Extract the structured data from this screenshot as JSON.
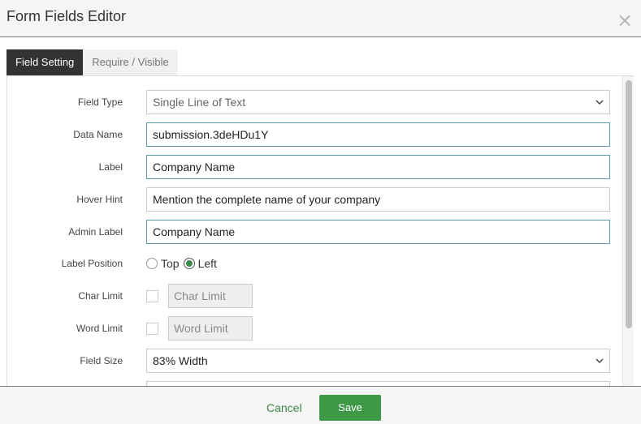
{
  "dialog": {
    "title": "Form Fields Editor",
    "close_icon": "close-icon"
  },
  "tabs": [
    {
      "label": "Field Setting",
      "active": true
    },
    {
      "label": "Require / Visible",
      "active": false
    }
  ],
  "fields": {
    "field_type": {
      "label": "Field Type",
      "value": "Single Line of Text"
    },
    "data_name": {
      "label": "Data Name",
      "value": "submission.3deHDu1Y"
    },
    "label": {
      "label": "Label",
      "value": "Company Name"
    },
    "hover_hint": {
      "label": "Hover Hint",
      "value": "Mention the complete name of your company"
    },
    "admin_label": {
      "label": "Admin Label",
      "value": "Company Name"
    },
    "label_position": {
      "label": "Label Position",
      "options": [
        "Top",
        "Left"
      ],
      "selected": "Left"
    },
    "char_limit": {
      "label": "Char Limit",
      "placeholder": "Char Limit",
      "checked": false
    },
    "word_limit": {
      "label": "Word Limit",
      "placeholder": "Word Limit",
      "checked": false
    },
    "field_size": {
      "label": "Field Size",
      "value": "83% Width"
    }
  },
  "footer": {
    "cancel_label": "Cancel",
    "save_label": "Save"
  },
  "colors": {
    "accent": "#3e9946",
    "active_tab": "#333333",
    "focus_border": "#5b9aa8"
  }
}
